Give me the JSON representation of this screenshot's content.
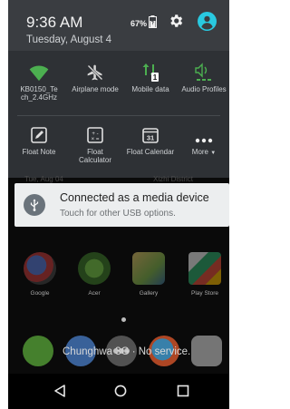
{
  "status": {
    "time": "9:36 AM",
    "date": "Tuesday, August 4",
    "battery_percent": "67%"
  },
  "colors": {
    "accent": "#29c9e0",
    "tile_icon": "#4caf50",
    "panel_bg": "#2e3135"
  },
  "quick_settings": {
    "row1": [
      {
        "label": "KB0150_Te ch_2.4GHz",
        "icon": "wifi-icon"
      },
      {
        "label": "Airplane mode",
        "icon": "airplane-mode-off-icon"
      },
      {
        "label": "Mobile data",
        "icon": "mobile-data-icon"
      },
      {
        "label": "Audio Profiles",
        "icon": "audio-profile-icon"
      }
    ],
    "row2": [
      {
        "label": "Float Note",
        "icon": "float-note-icon"
      },
      {
        "label": "Float Calculator",
        "icon": "float-calculator-icon"
      },
      {
        "label": "Float Calendar",
        "icon": "float-calendar-icon"
      },
      {
        "label": "More",
        "icon": "more-icon"
      }
    ],
    "calendar_day": "31"
  },
  "wallpaper_strip": {
    "left": "Tue, Aug 04",
    "right": "Xizhi District"
  },
  "notification": {
    "title": "Connected as a media device",
    "subtitle": "Touch for other USB options.",
    "icon": "usb-icon"
  },
  "home": {
    "apps": [
      {
        "name": "Google",
        "icon": "google-folder-icon"
      },
      {
        "name": "Acer",
        "icon": "acer-folder-icon"
      },
      {
        "name": "Gallery",
        "icon": "gallery-icon"
      },
      {
        "name": "Play Store",
        "icon": "play-store-icon"
      }
    ],
    "dock": [
      "phone-icon",
      "messages-icon",
      "app-drawer-icon",
      "browser-icon",
      "camera-icon"
    ],
    "toast": "Chunghwa 3G · No service."
  },
  "navbar": {
    "back": "back-icon",
    "home": "home-icon",
    "recents": "recents-icon"
  }
}
